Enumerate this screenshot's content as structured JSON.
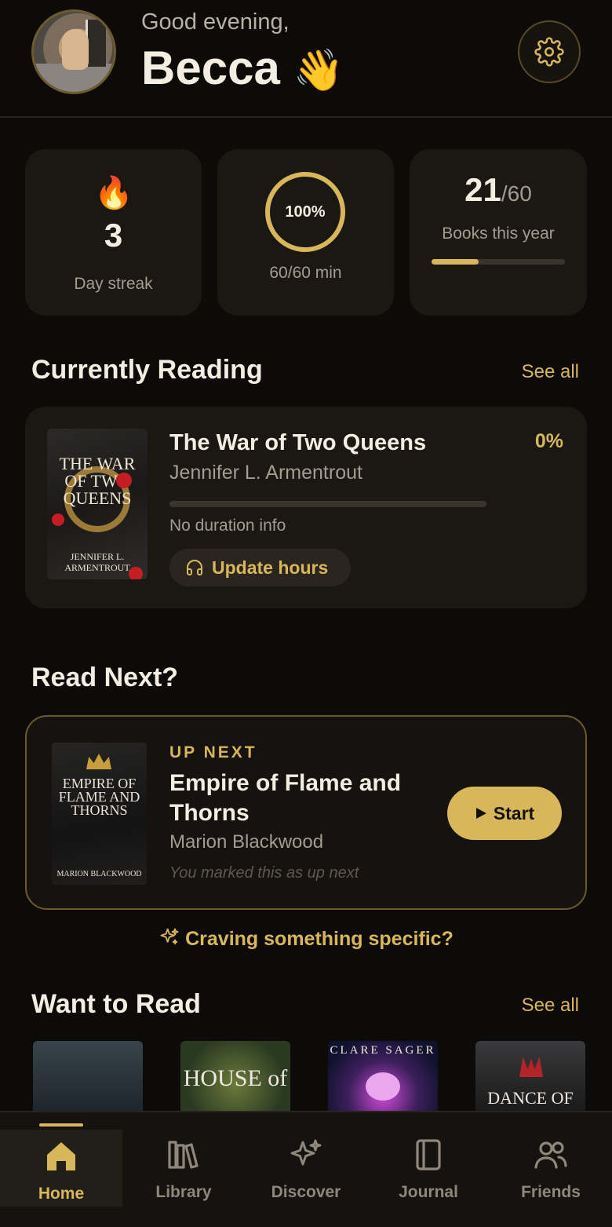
{
  "header": {
    "greeting": "Good evening,",
    "name": "Becca",
    "wave_emoji": "👋"
  },
  "stats": {
    "streak": {
      "emoji": "🔥",
      "value": "3",
      "label": "Day streak"
    },
    "minutes": {
      "percent_text": "100%",
      "fraction": 1.0,
      "label": "60/60 min"
    },
    "books": {
      "count": "21",
      "total": "/60",
      "label": "Books this year",
      "progress": 0.35
    }
  },
  "currently_reading": {
    "title": "Currently Reading",
    "see_all": "See all",
    "book": {
      "title": "The War of Two Queens",
      "author": "Jennifer L. Armentrout",
      "percent": "0%",
      "progress": 0.0,
      "duration_info": "No duration info",
      "update_button": "Update hours",
      "cover_title": "THE WAR OF TWO QUEENS",
      "cover_author": "JENNIFER L. ARMENTROUT"
    }
  },
  "read_next": {
    "title": "Read Next?",
    "tag": "UP NEXT",
    "book_title": "Empire of Flame and Thorns",
    "author": "Marion Blackwood",
    "note": "You marked this as up next",
    "start_button": "Start",
    "cover_title": "EMPIRE OF FLAME AND THORNS",
    "cover_author": "MARION BLACKWOOD"
  },
  "craving": "Craving something specific?",
  "want_to_read": {
    "title": "Want to Read",
    "see_all": "See all",
    "covers": [
      {
        "text": ""
      },
      {
        "text": "HOUSE of"
      },
      {
        "text": "CLARE SAGER"
      },
      {
        "text": "DANCE OF"
      }
    ]
  },
  "nav": {
    "items": [
      {
        "label": "Home",
        "icon": "home-icon"
      },
      {
        "label": "Library",
        "icon": "library-icon"
      },
      {
        "label": "Discover",
        "icon": "sparkles-icon"
      },
      {
        "label": "Journal",
        "icon": "journal-icon"
      },
      {
        "label": "Friends",
        "icon": "friends-icon"
      }
    ]
  },
  "colors": {
    "accent": "#d8b65a",
    "background": "#0d0b09",
    "card": "#1b1814"
  }
}
